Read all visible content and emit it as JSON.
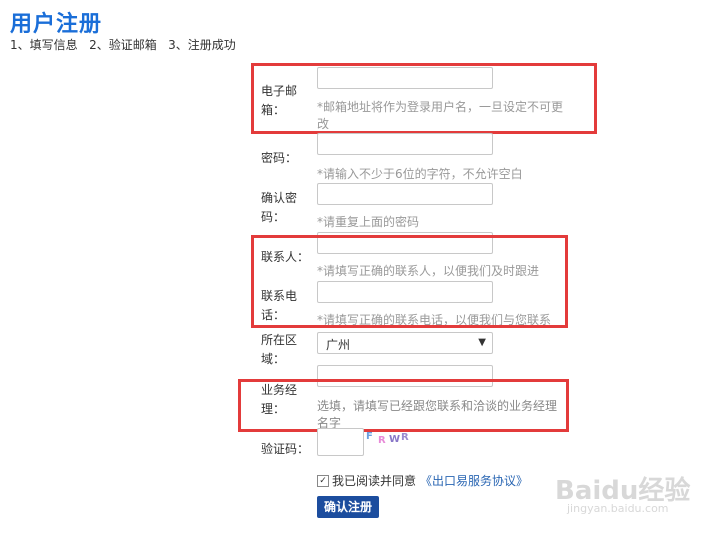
{
  "page": {
    "title": "用户注册",
    "steps": "1、填写信息   2、验证邮箱   3、注册成功"
  },
  "form": {
    "email": {
      "label_line1": "电子邮",
      "label_line2": "箱：",
      "value": "",
      "hint_line1": "*邮箱地址将作为登录用户名，一旦设定不可更",
      "hint_line2": "改"
    },
    "password": {
      "label": "密码：",
      "value": "",
      "hint": "*请输入不少于6位的字符，不允许空白"
    },
    "confirm_password": {
      "label_line1": "确认密",
      "label_line2": "码：",
      "value": "",
      "hint": "*请重复上面的密码"
    },
    "contact": {
      "label": "联系人：",
      "value": "",
      "hint": "*请填写正确的联系人，以便我们及时跟进"
    },
    "phone": {
      "label_line1": "联系电",
      "label_line2": "话：",
      "value": "",
      "hint": "*请填写正确的联系电话，以便我们与您联系"
    },
    "region": {
      "label_line1": "所在区",
      "label_line2": "域：",
      "selected": "广州"
    },
    "manager": {
      "label_line1": "业务经",
      "label_line2": "理：",
      "value": "",
      "hint_line1": "选填，请填写已经跟您联系和洽谈的业务经理",
      "hint_line2": "名字"
    },
    "captcha": {
      "label": "验证码：",
      "value": "",
      "chars": [
        "F",
        "R",
        "W",
        "R"
      ],
      "char_colors": [
        "#6aa0e0",
        "#e88ad8",
        "#8a78c8",
        "#9a8ad0"
      ]
    },
    "agreement": {
      "checked": true,
      "text": "我已阅读并同意",
      "link": "《出口易服务协议》"
    },
    "submit_label": "确认注册"
  },
  "watermark": {
    "brand": "Baidu经验",
    "url": "jingyan.baidu.com"
  },
  "colors": {
    "title": "#1a6ed8",
    "highlight_box": "#e33b3b",
    "submit_bg": "#1c4d9e",
    "link": "#2a66b3"
  }
}
